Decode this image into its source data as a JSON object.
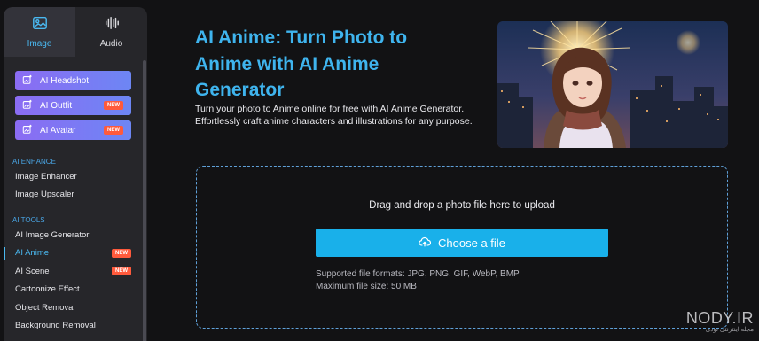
{
  "sidebar": {
    "tabs": [
      {
        "label": "Image",
        "icon": "image-icon",
        "active": true
      },
      {
        "label": "Audio",
        "icon": "waveform-icon",
        "active": false
      }
    ],
    "tools": [
      {
        "label": "AI Headshot",
        "badge": ""
      },
      {
        "label": "AI Outfit",
        "badge": "NEW"
      },
      {
        "label": "AI Avatar",
        "badge": "NEW"
      }
    ],
    "enhance_title": "AI ENHANCE",
    "enhance_items": [
      "Image Enhancer",
      "Image Upscaler"
    ],
    "tools_title": "AI TOOLS",
    "tool_items": [
      {
        "label": "AI Image Generator",
        "badge": ""
      },
      {
        "label": "AI Anime",
        "badge": "NEW",
        "active": true
      },
      {
        "label": "AI Scene",
        "badge": "NEW"
      },
      {
        "label": "Cartoonize Effect",
        "badge": ""
      },
      {
        "label": "Object Removal",
        "badge": ""
      },
      {
        "label": "Background Removal",
        "badge": ""
      }
    ],
    "accent": "#4ab8f0",
    "badge_color": "#ff5a3c"
  },
  "main": {
    "headline": "AI Anime: Turn Photo to Anime with AI Anime Generator",
    "description": "Turn your photo to Anime online for free with AI Anime Generator. Effortlessly craft anime characters and illustrations for any purpose.",
    "upload": {
      "prompt": "Drag and drop a photo file here to upload",
      "button_label": "Choose a file",
      "formats": "Supported file formats: JPG, PNG, GIF, WebP, BMP",
      "max_size": "Maximum file size: 50 MB"
    },
    "button_color": "#19b0ea"
  },
  "watermark": {
    "main": "NODY.IR",
    "sub": "مجله اینترنتی نودی"
  }
}
